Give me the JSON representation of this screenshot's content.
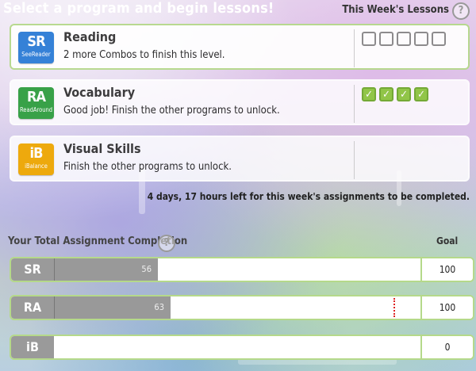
{
  "header": {
    "title": "Select a program and begin lessons!",
    "weekly_label": "This Week's Lessons",
    "help_glyph": "?"
  },
  "programs": [
    {
      "logo_text": "SR",
      "logo_sub": "SeeReader",
      "logo_color": "#2a7bd6",
      "name": "Reading",
      "desc": "2 more Combos to finish this level.",
      "lessons": [
        false,
        false,
        false,
        false,
        false
      ]
    },
    {
      "logo_text": "RA",
      "logo_sub": "ReadAround",
      "logo_color": "#2e9e3e",
      "name": "Vocabulary",
      "desc": "Good job! Finish the other programs to unlock.",
      "lessons": [
        true,
        true,
        true,
        true
      ]
    },
    {
      "logo_text": "iB",
      "logo_sub": "iBalance",
      "logo_color": "#f0a800",
      "name": "Visual Skills",
      "desc": "Finish the other programs to unlock.",
      "lessons": []
    }
  ],
  "time_left": "4 days, 17 hours left for this week's assignments to be completed.",
  "completion": {
    "label": "Your Total Assignment Completion",
    "goal_label": "Goal",
    "rows": [
      {
        "icon": "SR",
        "value": 56,
        "value_text": "56",
        "goal": "100",
        "show_marker": false
      },
      {
        "icon": "RA",
        "value": 63,
        "value_text": "63",
        "goal": "100",
        "show_marker": true,
        "marker_value": 100
      },
      {
        "icon": "iB",
        "value": 0,
        "value_text": "",
        "goal": "0",
        "show_marker": false
      }
    ]
  },
  "colors": {
    "card_border": "#b5d98a",
    "check_green": "#8dc63f",
    "marker_red": "#dd2222"
  }
}
